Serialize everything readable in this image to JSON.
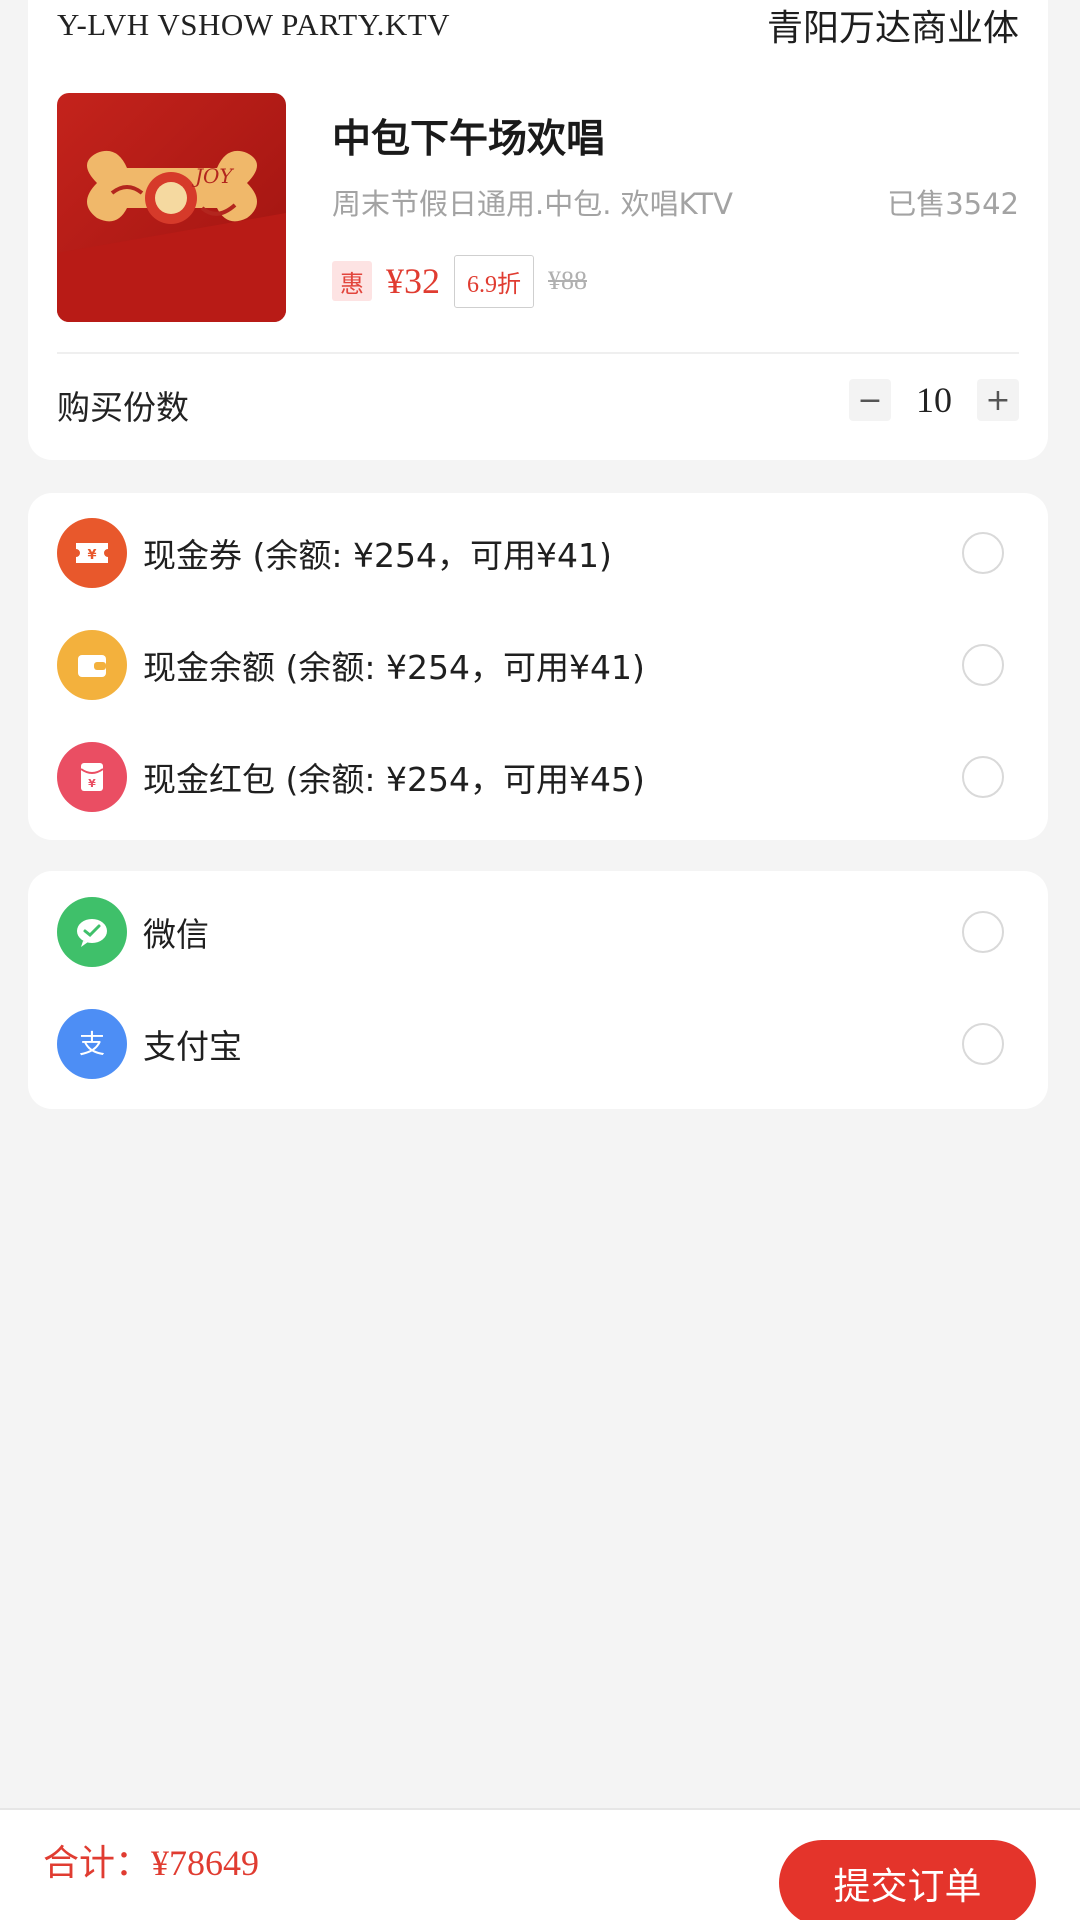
{
  "shop": {
    "name": "Y-LVH VSHOW PARTY.KTV",
    "location": "青阳万达商业体"
  },
  "product": {
    "title": "中包下午场欢唱",
    "description": "周末节假日通用.中包. 欢唱KTV",
    "sold": "已售3542",
    "deal_badge": "惠",
    "price": "¥32",
    "discount": "6.9折",
    "original_price": "¥88",
    "image_text": "JOY",
    "image_icon": "gift-box-image"
  },
  "quantity": {
    "label": "购买份数",
    "minus": "−",
    "value": "10",
    "plus": "+"
  },
  "balances": [
    {
      "label": "现金券 (余额: ¥254，可用¥41)",
      "icon": "coupon-icon",
      "color": "#e8582c"
    },
    {
      "label": "现金余额 (余额: ¥254，可用¥41)",
      "icon": "wallet-icon",
      "color": "#f3b13d"
    },
    {
      "label": "现金红包 (余额: ¥254，可用¥45)",
      "icon": "red-packet-icon",
      "color": "#ea4e63"
    }
  ],
  "payment_methods": [
    {
      "label": "微信",
      "icon": "wechat-icon",
      "color": "#3fc06a"
    },
    {
      "label": "支付宝",
      "icon": "alipay-icon",
      "color": "#4d8ef5"
    }
  ],
  "footer": {
    "total_label": "合计：",
    "total_amount": "¥78649",
    "submit_label": "提交订单"
  },
  "colors": {
    "accent": "#e4342b",
    "price": "#e03c31"
  }
}
